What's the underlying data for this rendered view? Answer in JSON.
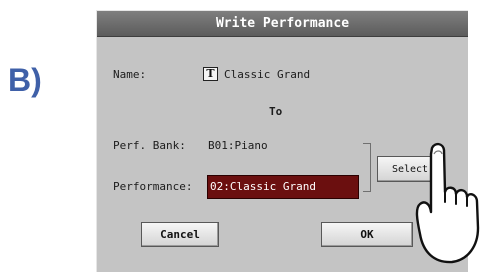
{
  "section_label": "B)",
  "dialog": {
    "title": "Write Performance",
    "name_label": "Name:",
    "name_value": "Classic Grand",
    "text_edit_icon": "T",
    "to_label": "To",
    "bank_label": "Perf. Bank:",
    "bank_value": "B01:Piano",
    "performance_label": "Performance:",
    "performance_value": "02:Classic Grand",
    "select_button": "Select",
    "cancel_button": "Cancel",
    "ok_button": "OK"
  },
  "colors": {
    "accent_label": "#3f60a8",
    "titlebar": "#666666",
    "dialog_bg": "#c4c4c4",
    "selected_field": "#6b0f0f"
  },
  "icons": [
    "text-edit-icon",
    "pointing-hand-icon"
  ]
}
